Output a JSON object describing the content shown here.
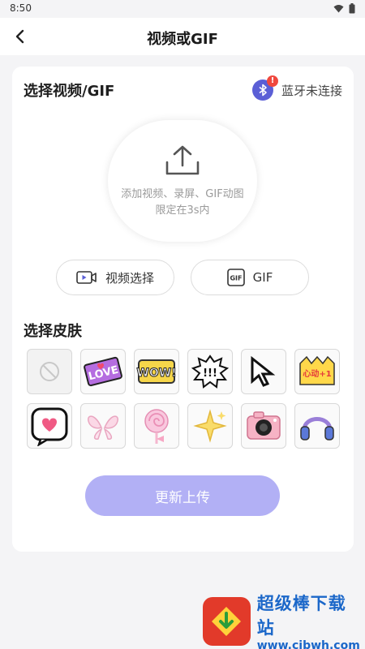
{
  "status_bar": {
    "time": "8:50",
    "icons": [
      "wifi-icon",
      "battery-icon"
    ]
  },
  "header": {
    "title": "视频或GIF",
    "back_icon": "chevron-left-icon"
  },
  "select_section": {
    "title": "选择视频/GIF",
    "bluetooth": {
      "status": "蓝牙未连接",
      "alert": "!"
    },
    "upload": {
      "line1": "添加视频、录屏、GIF动图",
      "line2": "限定在3s内"
    },
    "video_button": "视频选择",
    "gif_button": "GIF",
    "gif_icon_text": "GIF"
  },
  "skins_section": {
    "title": "选择皮肤",
    "items": [
      {
        "name": "none",
        "icon": "no-skin-icon"
      },
      {
        "name": "love",
        "text": "LOVE"
      },
      {
        "name": "wow",
        "text": "WOW!"
      },
      {
        "name": "exclaim",
        "text": "!!!"
      },
      {
        "name": "cursor",
        "icon": "pixel-cursor-icon"
      },
      {
        "name": "crown",
        "text": "心动+1"
      },
      {
        "name": "heart-bubble",
        "icon": "pixel-heart-icon"
      },
      {
        "name": "wings",
        "icon": "wings-icon"
      },
      {
        "name": "lollipop",
        "icon": "lollipop-icon"
      },
      {
        "name": "sparkle",
        "icon": "sparkle-icon"
      },
      {
        "name": "camera",
        "icon": "camera-icon"
      },
      {
        "name": "headphones",
        "icon": "headphones-icon"
      }
    ]
  },
  "update_button": "更新上传",
  "watermark": {
    "title": "超级棒下载站",
    "url": "www.cjbwh.com"
  },
  "colors": {
    "accent": "#5b5fd6",
    "button": "#b2b0f5",
    "alert": "#f0483e",
    "watermark": "#1b67c9"
  }
}
